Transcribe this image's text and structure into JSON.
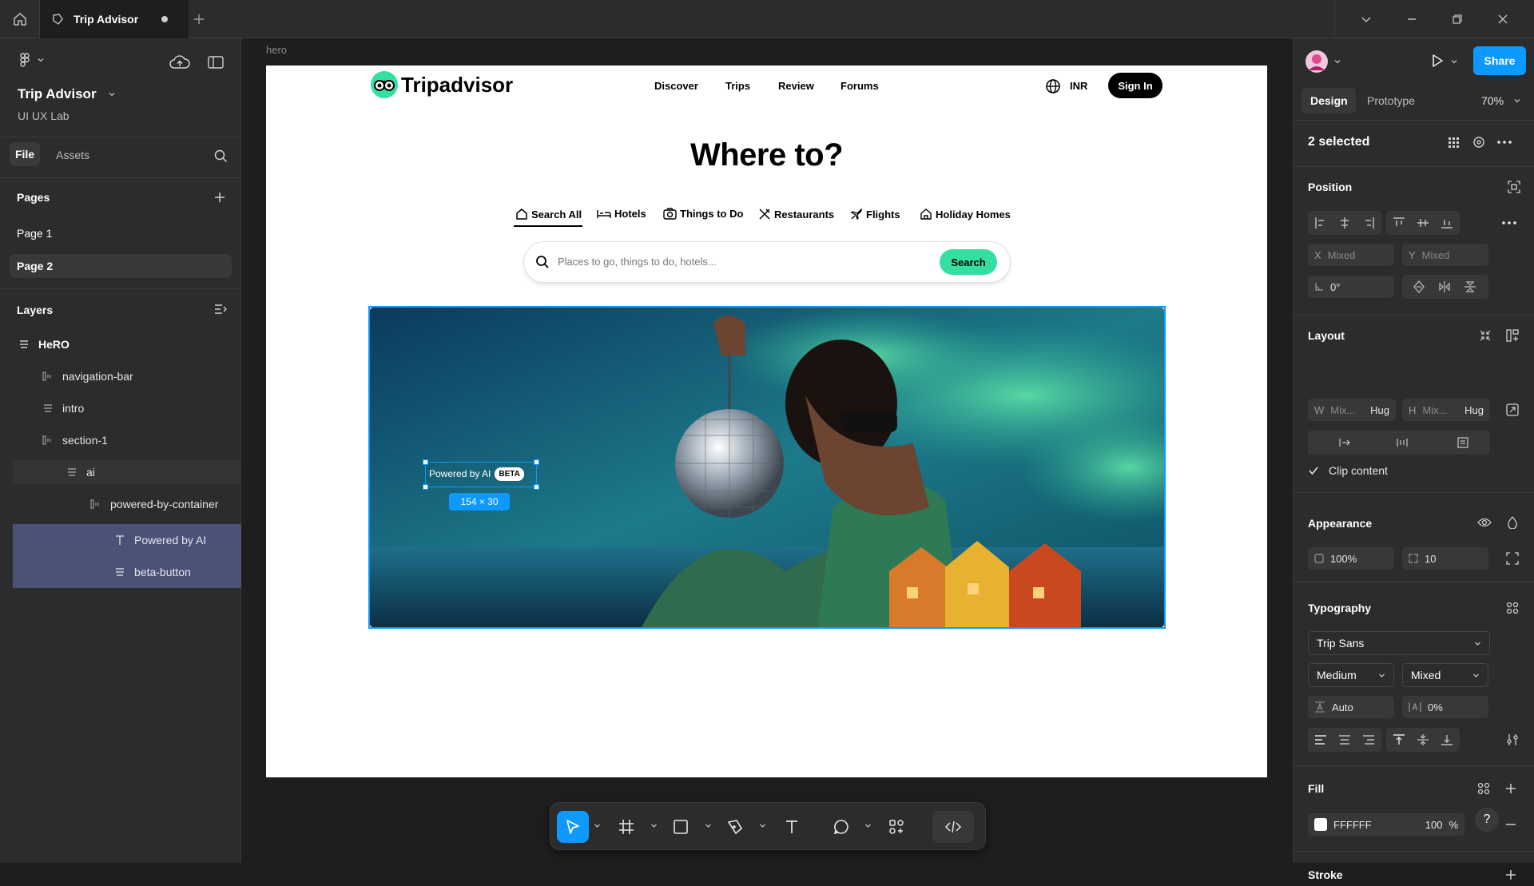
{
  "titlebar": {
    "tab_title": "Trip Advisor",
    "icons": [
      "home-icon",
      "file-icon",
      "plus-icon",
      "chevron-down-icon",
      "minimize-icon",
      "restore-icon",
      "close-icon"
    ]
  },
  "left_panel": {
    "project_title": "Trip Advisor",
    "team": "UI UX Lab",
    "tabs": {
      "file": "File",
      "assets": "Assets"
    },
    "pages_heading": "Pages",
    "pages": [
      "Page 1",
      "Page 2"
    ],
    "layers_heading": "Layers",
    "layers": {
      "hero": "HeRO",
      "navigation_bar": "navigation-bar",
      "intro": "intro",
      "section_1": "section-1",
      "ai": "ai",
      "powered_by_container": "powered-by-container",
      "powered_by_ai": "Powered by AI",
      "beta_button": "beta-button"
    }
  },
  "canvas": {
    "frame_label": "hero",
    "site": {
      "logo": "Tripadvisor",
      "nav": [
        "Discover",
        "Trips",
        "Review",
        "Forums"
      ],
      "currency": "INR",
      "sign_in": "Sign In",
      "headline": "Where to?",
      "search_tabs": [
        "Search All",
        "Hotels",
        "Things to Do",
        "Restaurants",
        "Flights",
        "Holiday Homes"
      ],
      "search_placeholder": "Places to go, things to do, hotels...",
      "search_button": "Search",
      "powered_by": "Powered by AI",
      "beta": "BETA",
      "accent_color": "#34e0a1"
    },
    "selection_size": "154 × 30",
    "selection_color": "#0d99ff"
  },
  "toolbar": {
    "tools": [
      "move-tool",
      "frame-tool",
      "rectangle-tool",
      "pen-tool",
      "text-tool",
      "comment-tool",
      "actions-tool",
      "dev-mode-toggle"
    ]
  },
  "right_panel": {
    "share": "Share",
    "tabs": {
      "design": "Design",
      "prototype": "Prototype"
    },
    "zoom": "70%",
    "selection": "2 selected",
    "position": {
      "heading": "Position",
      "x_label": "X",
      "x": "Mixed",
      "y_label": "Y",
      "y": "Mixed",
      "rotation": "0°"
    },
    "layout": {
      "heading": "Layout",
      "w_label": "W",
      "w": "Mix...",
      "w_mode": "Hug",
      "h_label": "H",
      "h": "Mix...",
      "h_mode": "Hug",
      "clip": "Clip content"
    },
    "appearance": {
      "heading": "Appearance",
      "opacity": "100%",
      "radius": "10"
    },
    "typography": {
      "heading": "Typography",
      "font": "Trip Sans",
      "weight": "Medium",
      "size": "Mixed",
      "line_height": "Auto",
      "letter_spacing": "0%"
    },
    "fill": {
      "heading": "Fill",
      "hex": "FFFFFF",
      "opacity": "100",
      "unit": "%"
    },
    "stroke": {
      "heading": "Stroke"
    },
    "help": "?"
  }
}
